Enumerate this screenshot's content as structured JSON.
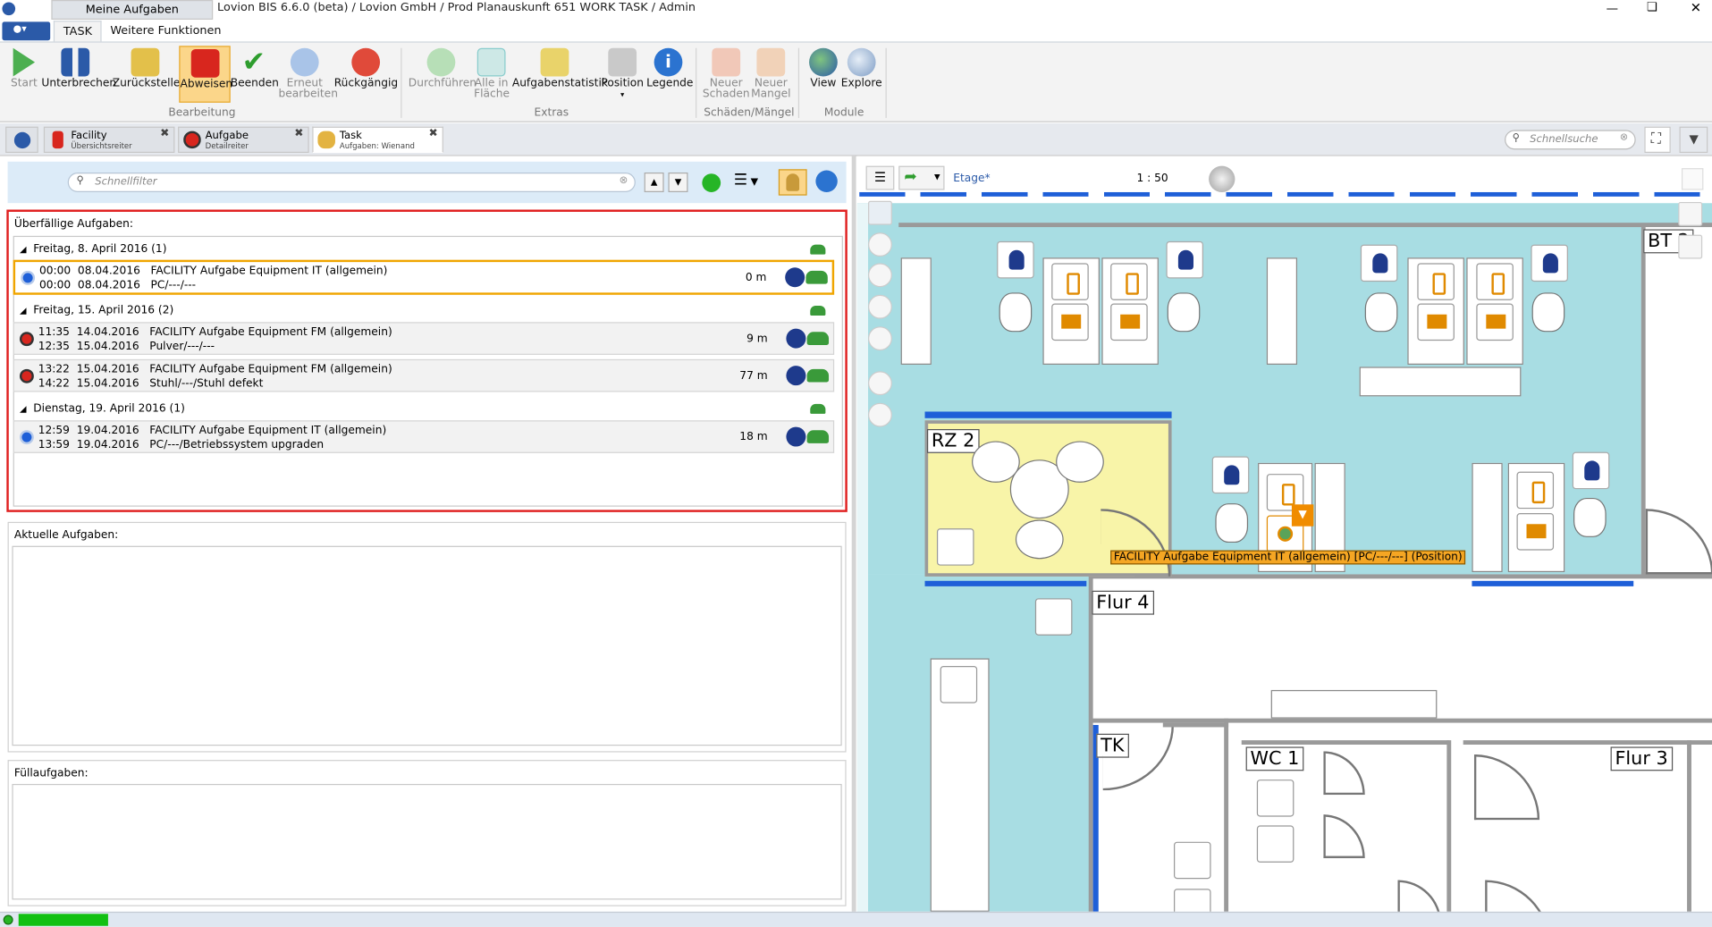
{
  "window": {
    "title": "Lovion BIS 6.6.0 (beta) / Lovion GmbH / Prod Planauskunft 651 WORK TASK / Admin",
    "top_tab": "Meine Aufgaben"
  },
  "ribbon": {
    "tabs": [
      "TASK",
      "Weitere Funktionen"
    ],
    "buttons": {
      "start": "Start",
      "unterbrechen": "Unterbrechen",
      "zurueckstellen": "Zurückstellen",
      "abweisen": "Abweisen",
      "beenden": "Beenden",
      "erneut": "Erneut bearbeiten",
      "rueckgaengig": "Rückgängig",
      "durchfuehren": "Durchführen",
      "alle_in_flaeche": "Alle in Fläche",
      "aufgabenstatistik": "Aufgabenstatistik",
      "position": "Position",
      "legende": "Legende",
      "neuer_schaden": "Neuer Schaden",
      "neuer_mangel": "Neuer Mangel",
      "view": "View",
      "explore": "Explore"
    },
    "groups": {
      "bearbeitung": "Bearbeitung",
      "extras": "Extras",
      "schaeden": "Schäden/Mängel",
      "module": "Module"
    }
  },
  "doc_tabs": [
    {
      "title": "Facility",
      "subtitle": "Übersichtsreiter"
    },
    {
      "title": "Aufgabe",
      "subtitle": "Detailreiter"
    },
    {
      "title": "Task",
      "subtitle": "Aufgaben: Wienand"
    }
  ],
  "quick_search": {
    "placeholder": "Schnellsuche"
  },
  "left": {
    "filter_placeholder": "Schnellfilter",
    "overdue_title": "Überfällige Aufgaben:",
    "groups": [
      {
        "label": "Freitag, 8. April 2016 (1)"
      },
      {
        "label": "Freitag, 15. April 2016 (2)"
      },
      {
        "label": "Dienstag, 19. April 2016 (1)"
      }
    ],
    "tasks": [
      {
        "line1": "00:00  08.04.2016   FACILITY Aufgabe Equipment IT (allgemein)",
        "line2": "00:00  08.04.2016   PC/---/---",
        "duration": "0 m",
        "status_color": "#1e5fd8"
      },
      {
        "line1": "11:35  14.04.2016   FACILITY Aufgabe Equipment FM (allgemein)",
        "line2": "12:35  15.04.2016   Pulver/---/---",
        "duration": "9 m",
        "status_color": "#d8261e"
      },
      {
        "line1": "13:22  15.04.2016   FACILITY Aufgabe Equipment FM (allgemein)",
        "line2": "14:22  15.04.2016   Stuhl/---/Stuhl defekt",
        "duration": "77 m",
        "status_color": "#d8261e"
      },
      {
        "line1": "12:59  19.04.2016   FACILITY Aufgabe Equipment IT (allgemein)",
        "line2": "13:59  19.04.2016   PC/---/Betriebssystem upgraden",
        "duration": "18 m",
        "status_color": "#1e5fd8"
      }
    ],
    "current_title": "Aktuelle Aufgaben:",
    "fill_title": "Füllaufgaben:"
  },
  "map": {
    "layer": "Etage*",
    "scale": "1 : 50",
    "rooms": {
      "rz2": "RZ 2",
      "bt2": "BT 2",
      "flur4": "Flur 4",
      "tk": "TK",
      "wc1": "WC 1",
      "flur3": "Flur 3"
    },
    "tooltip": "FACILITY Aufgabe Equipment IT (allgemein) [PC/---/---] (Position)"
  },
  "colors": {
    "accent_blue": "#1e5fd8",
    "overdue_red": "#d8261e",
    "selection_orange": "#f0a500",
    "map_teal": "#a8dde3",
    "rz_yellow": "#f8f4a8"
  }
}
